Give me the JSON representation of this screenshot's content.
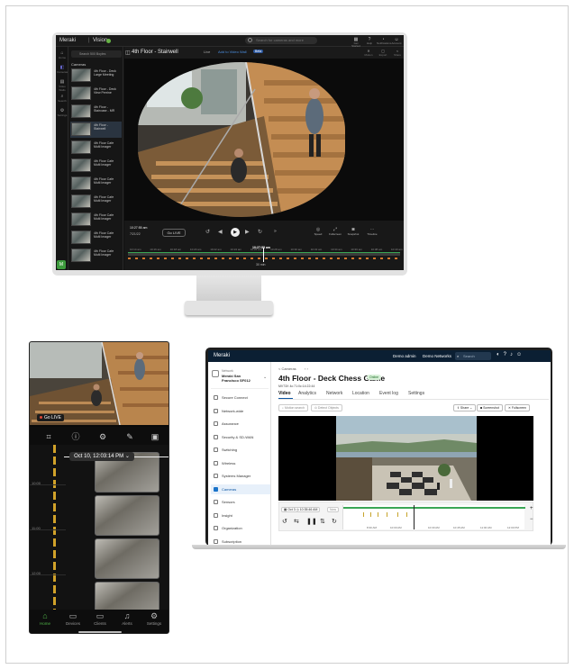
{
  "vision": {
    "logo": "Meraki",
    "app": "Vision",
    "search_placeholder": "Search for cameras and more",
    "top_icons": [
      {
        "icon": "grid-icon",
        "label": "Get Started"
      },
      {
        "icon": "help-icon",
        "label": "Help"
      },
      {
        "icon": "bell-icon",
        "label": "Notifications"
      },
      {
        "icon": "user-icon",
        "label": "Account"
      }
    ],
    "nav": [
      {
        "icon": "home-icon",
        "label": "Home"
      },
      {
        "icon": "camera-icon",
        "label": "Cameras"
      },
      {
        "icon": "video-wall-icon",
        "label": "Video Walls"
      },
      {
        "icon": "search-icon",
        "label": "Search"
      },
      {
        "icon": "settings-icon",
        "label": "Settings"
      }
    ],
    "cam_search": "Search 500 Boyles",
    "cameras_heading": "Cameras",
    "cameras": [
      "4th Floor - Deck\nLarge Meeting",
      "4th Floor - Deck\nView Perrine",
      "4th Floor -\nStaircase - MR",
      "4th Floor -\nStairwell",
      "4th Floor Cafe\nMulti Imager",
      "4th Floor Cafe\nMulti Imager",
      "4th Floor Cafe\nMulti Imager",
      "4th Floor Cafe\nMulti Imager",
      "4th Floor Cafe\nMulti Imager",
      "4th Floor Cafe\nMulti Imager",
      "4th Floor Cafe\nMulti Imager"
    ],
    "video_title": "4th Floor - Stairwell",
    "live_label": "Live",
    "add_wall": "Add to Video Wall",
    "beta": "Beta",
    "video_icons": [
      "Motion",
      "Export",
      "Share"
    ],
    "time": "10:27:55 am",
    "date_small": "7/21/22",
    "go_live": "Go LIVE",
    "time_center": "10:27:55 am",
    "tick_labels": [
      "10:14 am",
      "10:16 am",
      "10:18 am",
      "10:20 am",
      "10:22 am",
      "10:24 am",
      "10:26 am",
      "10:28 am",
      "10:30 am",
      "10:32 am",
      "10:34 am",
      "10:36 am",
      "10:38 am",
      "10:40 am"
    ],
    "ctrl_labels": [
      "Speed",
      "Fullscreen",
      "Snapshot",
      "Timeline"
    ],
    "zoom": "30 min",
    "badge": "M"
  },
  "phone": {
    "live": "Go LIVE",
    "date": "Oct 10, 12:03:14 PM",
    "times": [
      "10:00",
      "11:00",
      "12:00"
    ],
    "tools": [
      "crop-icon",
      "info-icon",
      "settings-icon",
      "wrench-icon",
      "trash-icon"
    ],
    "nav": [
      {
        "icon": "home-icon",
        "label": "Home"
      },
      {
        "icon": "devices-icon",
        "label": "Devices"
      },
      {
        "icon": "clients-icon",
        "label": "Clients"
      },
      {
        "icon": "bell-icon",
        "label": "Alerts"
      },
      {
        "icon": "gear-icon",
        "label": "Settings"
      }
    ]
  },
  "dashboard": {
    "logo": "Meraki",
    "user": "Demo admin",
    "org": "Demo Networks",
    "search": "Search",
    "network_label": "Network",
    "network_name": "Meraki San Francisco SF012",
    "menu": [
      "Secure Connect",
      "Network-wide",
      "Assurance",
      "Security & SD-WAN",
      "Switching",
      "Wireless",
      "Systems Manager",
      "Cameras",
      "Sensors",
      "Insight",
      "Organization",
      "Subscription"
    ],
    "active_menu": 7,
    "breadcrumb": "< Cameras",
    "title": "4th Floor - Deck Chess Game",
    "status": "Online",
    "model": "MV73X  4c:71:0c:14:22:44",
    "tabs": [
      "Video",
      "Analytics",
      "Network",
      "Location",
      "Event log",
      "Settings"
    ],
    "active_tab": 0,
    "left_buttons": [
      "Motion search",
      "Detect Objects"
    ],
    "right_buttons": [
      "Share",
      "Screenshot",
      "Fullscreen"
    ],
    "date": "Oct 3",
    "time": "10:35:46 AM",
    "now": "Now",
    "ticks": [
      "8:30 AM",
      "10:00 AM",
      "10:30 AM",
      "10:45 AM",
      "11:00 AM",
      "12:00 PM"
    ],
    "zoom_in": "+",
    "zoom_out": "−"
  }
}
